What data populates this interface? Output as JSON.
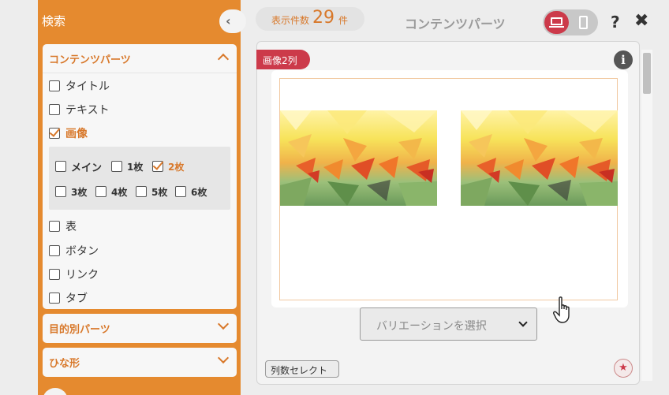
{
  "sidebar": {
    "title": "検索",
    "collapse_icon": "‹",
    "panels": {
      "content_parts": {
        "title": "コンテンツパーツ",
        "items": [
          {
            "label": "タイトル",
            "checked": false
          },
          {
            "label": "テキスト",
            "checked": false
          },
          {
            "label": "画像",
            "checked": true
          },
          {
            "label": "表",
            "checked": false
          },
          {
            "label": "ボタン",
            "checked": false
          },
          {
            "label": "リンク",
            "checked": false
          },
          {
            "label": "タブ",
            "checked": false
          }
        ],
        "image_sub": [
          {
            "label": "メイン",
            "checked": false
          },
          {
            "label": "1枚",
            "checked": false
          },
          {
            "label": "2枚",
            "checked": true
          },
          {
            "label": "3枚",
            "checked": false
          },
          {
            "label": "4枚",
            "checked": false
          },
          {
            "label": "5枚",
            "checked": false
          },
          {
            "label": "6枚",
            "checked": false
          }
        ]
      },
      "purpose_parts": {
        "title": "目的別パーツ"
      },
      "templates": {
        "title": "ひな形"
      }
    }
  },
  "header": {
    "count_label": "表示件数",
    "count_value": "29",
    "count_unit": "件",
    "page_title": "コンテンツパーツ",
    "help_label": "?",
    "close_label": "✖"
  },
  "card": {
    "tag": "画像2列",
    "info_label": "i",
    "variation_placeholder": "バリエーションを選択",
    "column_select_label": "列数セレクト",
    "fav_label": "★"
  },
  "colors": {
    "accent_orange": "#e58a2f",
    "accent_red": "#cc3a4a"
  }
}
